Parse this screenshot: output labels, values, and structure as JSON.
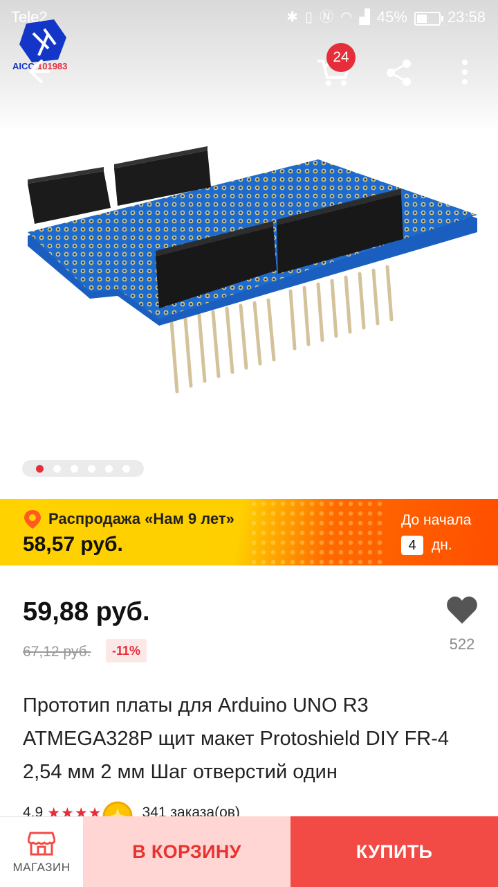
{
  "status_bar": {
    "carrier": "Tele2",
    "battery": "45%",
    "time": "23:58",
    "icons": [
      "bluetooth-icon",
      "vibrate-icon",
      "nfc-icon",
      "wifi-icon",
      "signal-icon",
      "battery-icon"
    ]
  },
  "header": {
    "logo_text": "AICC101983",
    "cart_count": "24",
    "icons": [
      "back-arrow-icon",
      "cart-icon",
      "share-icon",
      "more-vertical-icon"
    ]
  },
  "gallery": {
    "image_count": 6,
    "active_index": 0
  },
  "promo": {
    "title": "Распродажа «Нам 9 лет»",
    "price": "58,57 руб.",
    "until_label": "До начала",
    "days_value": "4",
    "days_unit": "дн."
  },
  "product": {
    "price": "59,88 руб.",
    "old_price": "67,12 руб.",
    "discount": "-11%",
    "wishlist_count": "522",
    "title": "Прототип платы для Arduino UNO R3 ATMEGA328P щит макет Protoshield DIY FR-4 2,54 мм 2 мм Шаг отверстий один",
    "rating": "4.9",
    "orders": "341 заказа(ов)"
  },
  "bottom_bar": {
    "shop_label": "МАГАЗИН",
    "add_to_cart_label": "В КОРЗИНУ",
    "buy_label": "КУПИТЬ"
  },
  "colors": {
    "accent_red": "#e62e3a",
    "buy_button": "#f24b45",
    "cart_button_bg": "#ffd6d4",
    "promo_yellow": "#ffd200",
    "promo_orange": "#ff4e00",
    "pcb_blue": "#1f6fc9"
  }
}
